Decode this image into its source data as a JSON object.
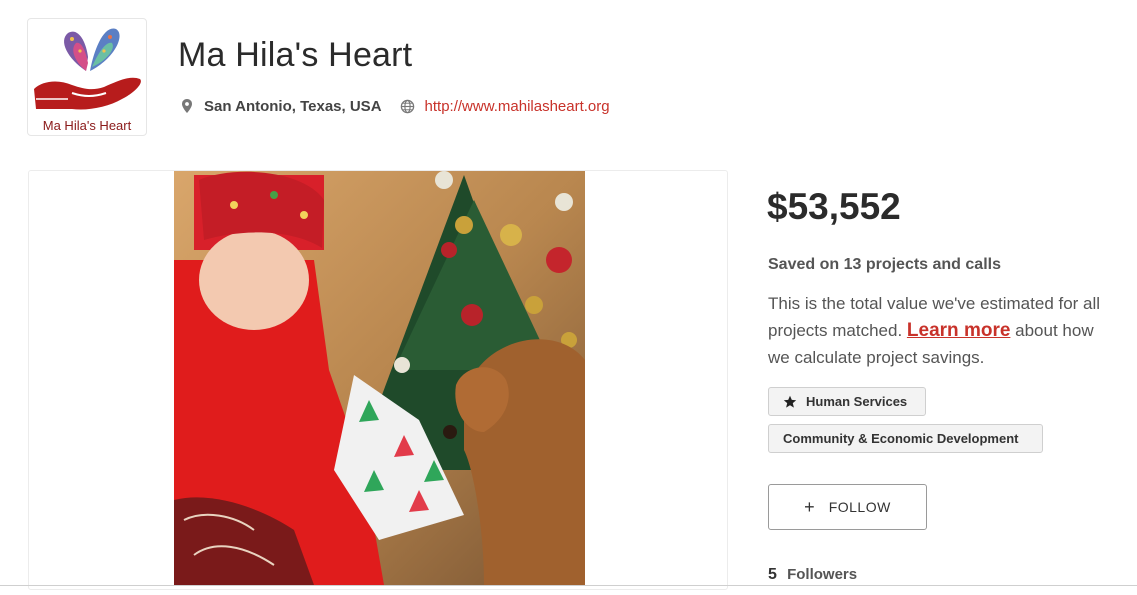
{
  "org": {
    "name": "Ma Hila's Heart",
    "logo_text": "Ma Hila's Heart",
    "location": "San Antonio, Texas, USA",
    "website": "http://www.mahilasheart.org"
  },
  "stats": {
    "amount": "$53,552",
    "saved_text": "Saved on 13 projects and calls",
    "desc_before": "This is the total value we've estimated for all projects matched.",
    "learn_more": "Learn more",
    "desc_after": "about how we calculate project savings."
  },
  "tags": [
    {
      "label": "Human Services",
      "icon": "star-icon"
    },
    {
      "label": "Community & Economic Development"
    }
  ],
  "follow": {
    "label": "FOLLOW",
    "icon": "plus-icon",
    "followers_count": "5",
    "followers_label": "Followers"
  },
  "colors": {
    "accent": "#c8322a",
    "logo_red": "#8b1a1a"
  }
}
